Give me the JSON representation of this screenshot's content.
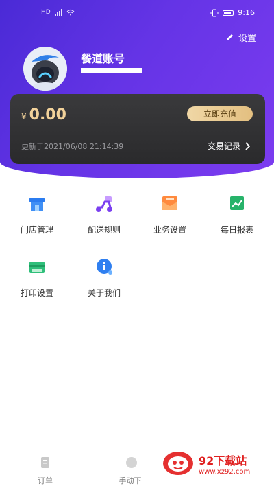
{
  "status_bar": {
    "time": "9:16",
    "left": "HD"
  },
  "header": {
    "settings_label": "设置",
    "account_name": "餐道账号"
  },
  "wallet": {
    "currency": "¥",
    "balance": "0.00",
    "recharge_label": "立即充值",
    "updated_text": "更新于2021/06/08 21:14:39",
    "records_label": "交易记录"
  },
  "menu": [
    {
      "label": "门店管理",
      "icon": "store-icon"
    },
    {
      "label": "配送规则",
      "icon": "delivery-scooter-icon"
    },
    {
      "label": "业务设置",
      "icon": "mail-settings-icon"
    },
    {
      "label": "每日报表",
      "icon": "chart-report-icon"
    },
    {
      "label": "打印设置",
      "icon": "printer-icon"
    },
    {
      "label": "关于我们",
      "icon": "info-icon"
    }
  ],
  "tabbar": [
    {
      "label": "订单",
      "icon": "order-doc-icon"
    },
    {
      "label": "手动下",
      "icon": "manual-icon"
    }
  ],
  "watermark": {
    "title": "92下载站",
    "url": "www.xz92.com"
  },
  "colors": {
    "header": "#5a2fe0",
    "gold": "#f2d29a",
    "card": "#2f2f31"
  }
}
